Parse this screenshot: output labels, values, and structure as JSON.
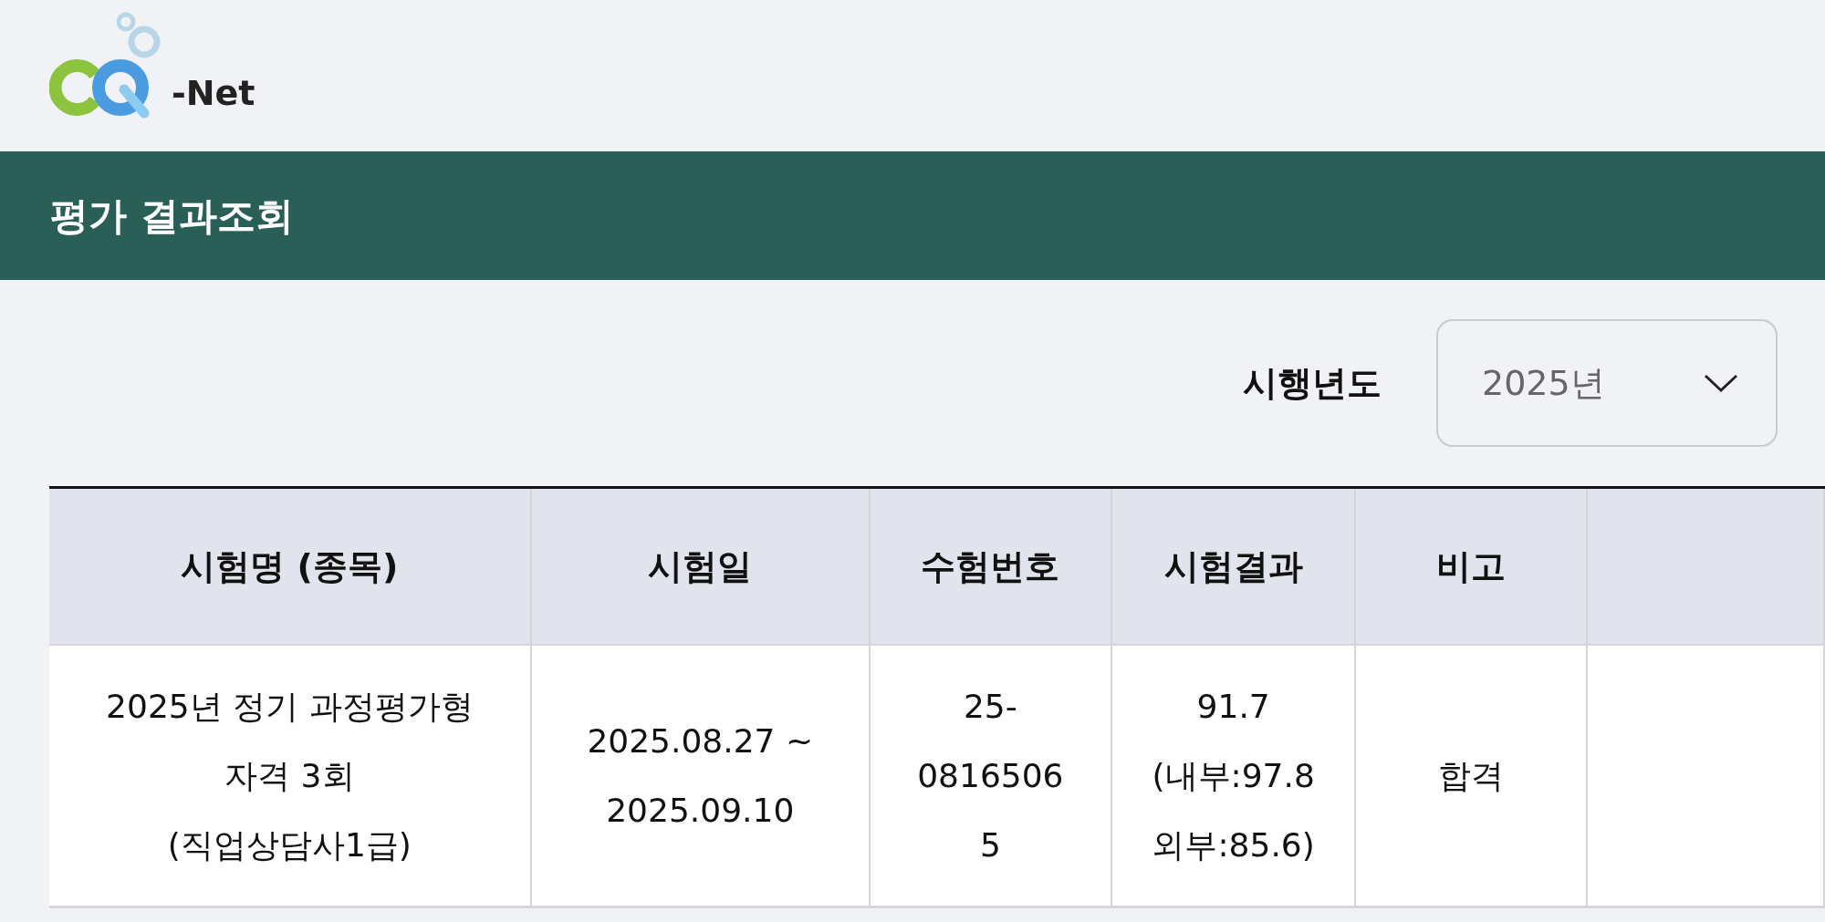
{
  "logo": {
    "text": "-Net"
  },
  "title_bar": {
    "title": "평가 결과조회"
  },
  "filter": {
    "label": "시행년도",
    "year_select": {
      "value": "2025년"
    }
  },
  "table": {
    "columns": [
      "시험명 (종목)",
      "시험일",
      "수험번호",
      "시험결과",
      "비고"
    ],
    "rows": [
      {
        "cells": [
          [
            "2025년 정기 과정평가형",
            "자격 3회",
            "(직업상담사1급)"
          ],
          [
            "2025.08.27 ~",
            "2025.09.10"
          ],
          [
            "25-",
            "0816506",
            "5"
          ],
          [
            "91.7",
            "(내부:97.8",
            "외부:85.6)"
          ],
          [
            "합격"
          ]
        ]
      }
    ]
  }
}
